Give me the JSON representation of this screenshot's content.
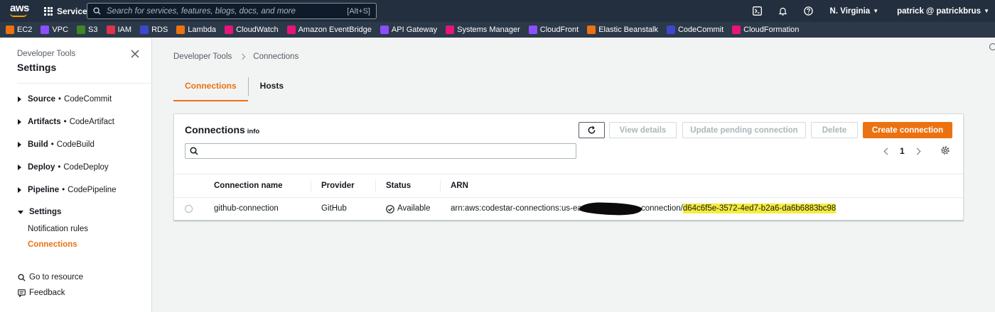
{
  "topnav": {
    "logo_text": "aws",
    "services_label": "Services",
    "search_placeholder": "Search for services, features, blogs, docs, and more",
    "search_shortcut": "[Alt+S]",
    "region": "N. Virginia",
    "user": "patrick @ patrickbrus"
  },
  "favorites": [
    {
      "label": "EC2",
      "color": "#ec7211"
    },
    {
      "label": "VPC",
      "color": "#8c4fff"
    },
    {
      "label": "S3",
      "color": "#3f8624"
    },
    {
      "label": "IAM",
      "color": "#dd344c"
    },
    {
      "label": "RDS",
      "color": "#3b48cc"
    },
    {
      "label": "Lambda",
      "color": "#ec7211"
    },
    {
      "label": "CloudWatch",
      "color": "#e7157b"
    },
    {
      "label": "Amazon EventBridge",
      "color": "#e7157b"
    },
    {
      "label": "API Gateway",
      "color": "#8c4fff"
    },
    {
      "label": "Systems Manager",
      "color": "#e7157b"
    },
    {
      "label": "CloudFront",
      "color": "#8c4fff"
    },
    {
      "label": "Elastic Beanstalk",
      "color": "#ec7211"
    },
    {
      "label": "CodeCommit",
      "color": "#3b48cc"
    },
    {
      "label": "CloudFormation",
      "color": "#e7157b"
    }
  ],
  "sidebar": {
    "subtitle": "Developer Tools",
    "title": "Settings",
    "sections": [
      {
        "name": "Source",
        "service": "CodeCommit"
      },
      {
        "name": "Artifacts",
        "service": "CodeArtifact"
      },
      {
        "name": "Build",
        "service": "CodeBuild"
      },
      {
        "name": "Deploy",
        "service": "CodeDeploy"
      },
      {
        "name": "Pipeline",
        "service": "CodePipeline"
      },
      {
        "name": "Settings",
        "service": ""
      }
    ],
    "bullet": "•",
    "links": [
      "Notification rules",
      "Connections"
    ],
    "go_to_resource": "Go to resource",
    "feedback": "Feedback"
  },
  "breadcrumb": [
    "Developer Tools",
    "Connections"
  ],
  "tabs": [
    "Connections",
    "Hosts"
  ],
  "panel": {
    "title": "Connections",
    "info": "Info",
    "buttons": {
      "view_details": "View details",
      "update_pending": "Update pending connection",
      "delete": "Delete",
      "create": "Create connection"
    },
    "filter_value": "",
    "page": "1",
    "columns": [
      "Connection name",
      "Provider",
      "Status",
      "ARN"
    ],
    "rows": [
      {
        "name": "github-connection",
        "provider": "GitHub",
        "status": "Available",
        "arn_prefix": "arn:aws:codestar-connections:us-east-1",
        "arn_mid": "connection/",
        "arn_id": "d64c6f5e-3572-4ed7-b2a6-da6b6883bc98"
      }
    ]
  },
  "colors": {
    "nav_bg": "#232f3e",
    "accent": "#ec7211",
    "status_ok": "#1d8102",
    "highlight": "#f5ec3c"
  }
}
